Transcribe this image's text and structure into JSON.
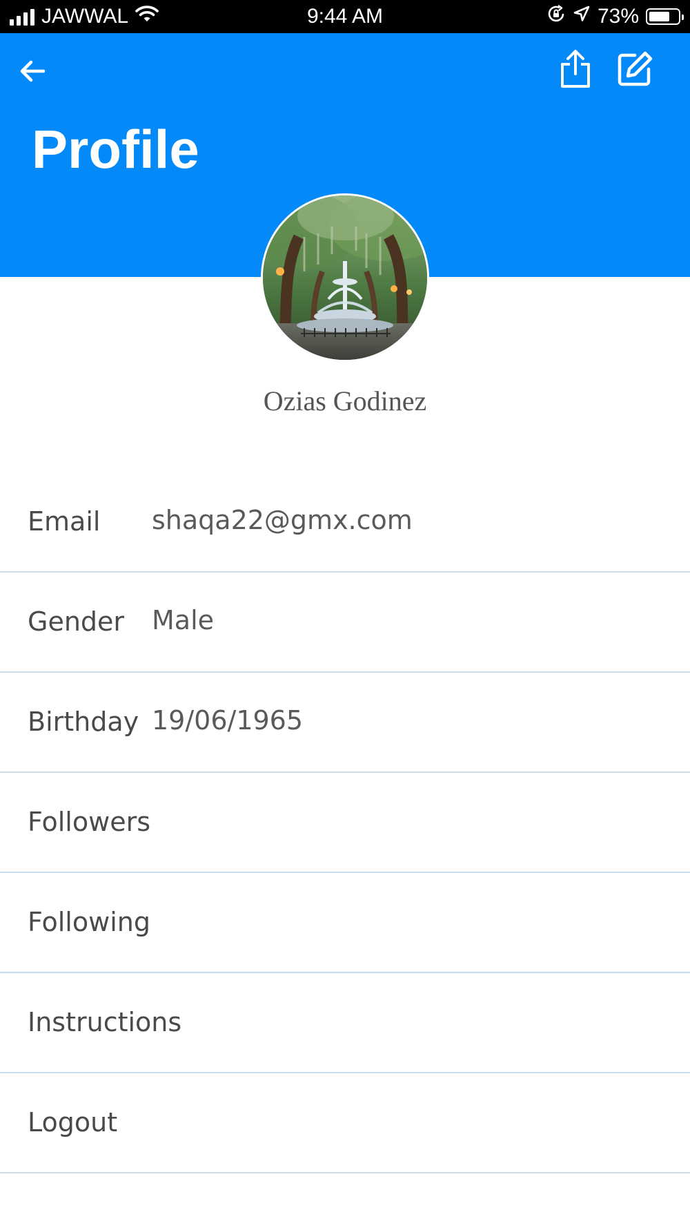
{
  "status_bar": {
    "carrier": "JAWWAL",
    "time": "9:44 AM",
    "battery_percent_label": "73%",
    "battery_level": 0.73,
    "icons": [
      "signal-icon",
      "wifi-icon",
      "orientation-lock-icon",
      "location-icon",
      "battery-icon"
    ]
  },
  "header": {
    "title": "Profile",
    "background_color": "#0389f8",
    "back_icon": "arrow-left-icon",
    "share_icon": "share-icon",
    "edit_icon": "edit-icon"
  },
  "profile": {
    "name": "Ozias Godinez",
    "avatar": "fountain-park-photo"
  },
  "details": [
    {
      "label": "Email",
      "value": "shaqa22@gmx.com"
    },
    {
      "label": "Gender",
      "value": "Male"
    },
    {
      "label": "Birthday",
      "value": "19/06/1965"
    }
  ],
  "menu": [
    {
      "label": "Followers"
    },
    {
      "label": "Following"
    },
    {
      "label": "Instructions"
    },
    {
      "label": "Logout"
    }
  ]
}
